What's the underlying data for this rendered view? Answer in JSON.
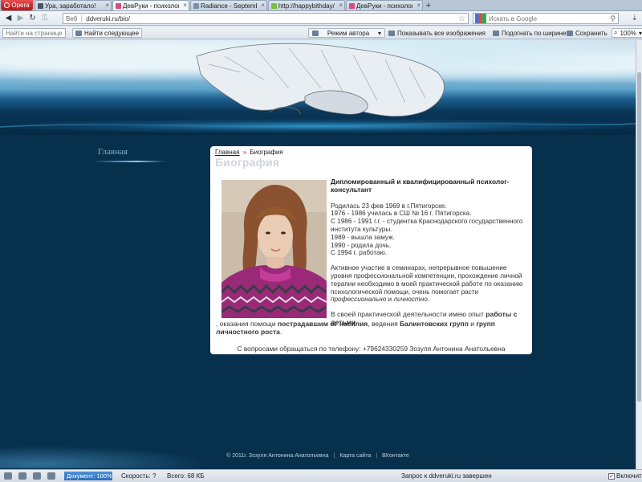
{
  "browser": {
    "menu_label": "Opera",
    "tabs": [
      {
        "label": "Ура, заработало!",
        "close": "×",
        "favicon_color": "#4a5566"
      },
      {
        "label": "ДевРуки - психолог-к...",
        "close": "×",
        "favicon_color": "#d94c7a",
        "active": true
      },
      {
        "label": "Radiance - September ...",
        "close": "×",
        "favicon_color": "#7a8fa5"
      },
      {
        "label": "http://happybithday/",
        "close": "×",
        "favicon_color": "#7bbf3a"
      },
      {
        "label": "ДевРуки - психолог-к...",
        "close": "×",
        "favicon_color": "#d94c7a"
      }
    ],
    "new_tab": "+",
    "address": {
      "scope": "Веб",
      "url": "ddveruki.ru/bio/"
    },
    "search_placeholder": "Искать в Google",
    "find_placeholder": "Найти на странице",
    "find_next": "Найти следующее",
    "author_mode": "Режим автора",
    "show_images": "Показывать все изображения",
    "fit_width": "Подогнать по ширине",
    "save": "Сохранить",
    "zoom": "100%"
  },
  "site": {
    "nav": {
      "home": "Главная"
    },
    "breadcrumb": {
      "home": "Главная",
      "separator": "»",
      "current": "Биография"
    },
    "title": "Биография",
    "bio_heading": "Дипломированный и квалифицированный психолог-консультант",
    "timeline": [
      "Родилась 23 фев 1969 в г.Пятигорске.",
      "1976 - 1986 училась в СШ № 16 г. Пятигорска.",
      "С 1986 - 1991 г.г. - студентка Краснодарского государственного института культуры.",
      "1989 - вышла замуж.",
      "1990 - родила дочь.",
      "С 1994 г. работаю."
    ],
    "activity_text": "Активное участие в семинарах, непрерывное повышение уровня профессиональной компетенции, прохождение личной терапии необходимо в моей практической работе по оказанию психологической помощи, очень помогает расти ",
    "activity_em1": "профессионально",
    "activity_and": " и ",
    "activity_em2": "личностно",
    "activity_end": ".",
    "practice": {
      "t1": "В своей практической деятельности имею опыт ",
      "b1": "работы с детьми",
      "t2": ", оказания помощи ",
      "b2": "пострадавшим от насилия",
      "t3": ", ведения ",
      "b3": "Балинтовских групп",
      "t4": " и ",
      "b4": "групп личностного роста",
      "t5": "."
    },
    "contact": "С вопросами обращаться по телефону: +79624330259 Зозуля Антонина Анатольевна",
    "footer": {
      "copyright": "© 2011г. Зозуля Антонина Анатольевна",
      "sep": "|",
      "sitemap": "Карта сайта",
      "vk": "ВКонтакте"
    }
  },
  "status": {
    "document": "Документ: 100%",
    "speed": "Скорость: ?",
    "total": "Всего: 68 КБ",
    "message": "Запрос к ddveruki.ru завершен",
    "enable": "Включить",
    "enable_check": "✓"
  }
}
